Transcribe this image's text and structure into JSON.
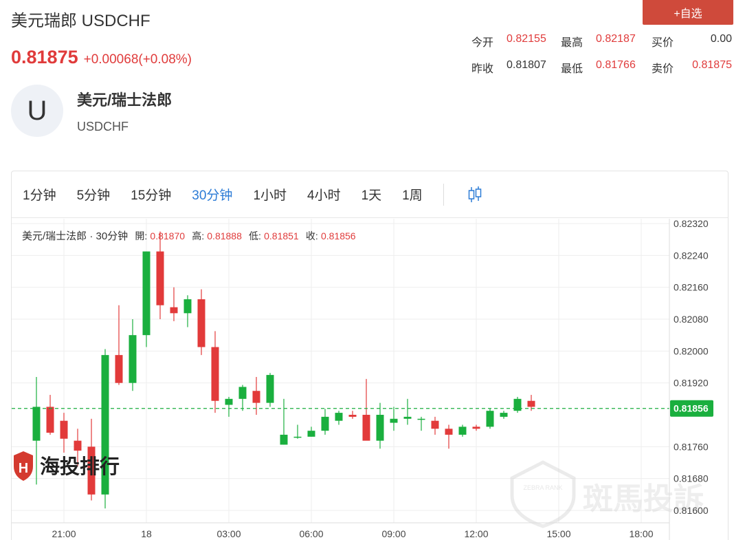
{
  "header": {
    "title": "美元瑞郎 USDCHF",
    "price": "0.81875",
    "change": "+0.00068(+0.08%)",
    "watch_button": "+自选"
  },
  "quote": {
    "open_label": "今开",
    "open": "0.82155",
    "high_label": "最高",
    "high": "0.82187",
    "bid_label": "买价",
    "bid": "0.00",
    "prev_close_label": "昨收",
    "prev_close": "0.81807",
    "low_label": "最低",
    "low": "0.81766",
    "ask_label": "卖价",
    "ask": "0.81875"
  },
  "instrument": {
    "avatar_letter": "U",
    "name": "美元/瑞士法郎",
    "code": "USDCHF"
  },
  "tabs": [
    "1分钟",
    "5分钟",
    "15分钟",
    "30分钟",
    "1小时",
    "4小时",
    "1天",
    "1周"
  ],
  "active_tab": "30分钟",
  "legend": {
    "series_name": "美元/瑞士法郎 · 30分钟",
    "open_label": "開:",
    "open": "0.81870",
    "high_label": "高:",
    "high": "0.81888",
    "low_label": "低:",
    "low": "0.81851",
    "close_label": "收:",
    "close": "0.81856"
  },
  "watermarks": {
    "left": "海投排行",
    "right": "斑馬投訴",
    "badge_text": "ZEBRA RANK"
  },
  "colors": {
    "up": "#1aaf3e",
    "down": "#e23a3a",
    "accent": "#2b7bd6",
    "button": "#cf4a3b"
  },
  "chart_data": {
    "type": "candlestick",
    "y_ticks": [
      "0.82320",
      "0.82240",
      "0.82160",
      "0.82080",
      "0.82000",
      "0.81920",
      "0.81760",
      "0.81680",
      "0.81600"
    ],
    "ylim": [
      0.8158,
      0.8232
    ],
    "x_ticks": [
      "21:00",
      "18",
      "03:00",
      "06:00",
      "09:00",
      "12:00",
      "15:00",
      "18:00"
    ],
    "current_price": 0.81856,
    "current_price_label": "0.81856",
    "candles": [
      {
        "o": 0.81775,
        "h": 0.81935,
        "l": 0.81665,
        "c": 0.8186
      },
      {
        "o": 0.8186,
        "h": 0.8189,
        "l": 0.8179,
        "c": 0.81795
      },
      {
        "o": 0.81825,
        "h": 0.81845,
        "l": 0.81745,
        "c": 0.8178
      },
      {
        "o": 0.81775,
        "h": 0.81805,
        "l": 0.8171,
        "c": 0.8175
      },
      {
        "o": 0.8176,
        "h": 0.8183,
        "l": 0.81625,
        "c": 0.8164
      },
      {
        "o": 0.8164,
        "h": 0.82005,
        "l": 0.81605,
        "c": 0.8199
      },
      {
        "o": 0.8199,
        "h": 0.82115,
        "l": 0.81915,
        "c": 0.8192
      },
      {
        "o": 0.8192,
        "h": 0.8208,
        "l": 0.819,
        "c": 0.8204
      },
      {
        "o": 0.8204,
        "h": 0.8225,
        "l": 0.8201,
        "c": 0.8225
      },
      {
        "o": 0.8225,
        "h": 0.823,
        "l": 0.8208,
        "c": 0.82115
      },
      {
        "o": 0.8211,
        "h": 0.8216,
        "l": 0.82075,
        "c": 0.82095
      },
      {
        "o": 0.82095,
        "h": 0.8214,
        "l": 0.8206,
        "c": 0.8213
      },
      {
        "o": 0.8213,
        "h": 0.82155,
        "l": 0.8199,
        "c": 0.8201
      },
      {
        "o": 0.8201,
        "h": 0.8205,
        "l": 0.81845,
        "c": 0.81875
      },
      {
        "o": 0.81865,
        "h": 0.81885,
        "l": 0.81835,
        "c": 0.8188
      },
      {
        "o": 0.8188,
        "h": 0.81915,
        "l": 0.8185,
        "c": 0.8191
      },
      {
        "o": 0.819,
        "h": 0.81935,
        "l": 0.8184,
        "c": 0.8187
      },
      {
        "o": 0.8187,
        "h": 0.81945,
        "l": 0.8186,
        "c": 0.8194
      },
      {
        "o": 0.81765,
        "h": 0.8188,
        "l": 0.81765,
        "c": 0.8179
      },
      {
        "o": 0.81785,
        "h": 0.81815,
        "l": 0.8178,
        "c": 0.81785
      },
      {
        "o": 0.81785,
        "h": 0.8181,
        "l": 0.81785,
        "c": 0.818
      },
      {
        "o": 0.818,
        "h": 0.81855,
        "l": 0.8179,
        "c": 0.81835
      },
      {
        "o": 0.81825,
        "h": 0.8185,
        "l": 0.81815,
        "c": 0.81845
      },
      {
        "o": 0.8184,
        "h": 0.8185,
        "l": 0.8183,
        "c": 0.81835
      },
      {
        "o": 0.8184,
        "h": 0.8193,
        "l": 0.81785,
        "c": 0.81775
      },
      {
        "o": 0.81775,
        "h": 0.8187,
        "l": 0.81755,
        "c": 0.8184
      },
      {
        "o": 0.8182,
        "h": 0.8186,
        "l": 0.818,
        "c": 0.8183
      },
      {
        "o": 0.8183,
        "h": 0.8188,
        "l": 0.81815,
        "c": 0.81835
      },
      {
        "o": 0.8183,
        "h": 0.81835,
        "l": 0.818,
        "c": 0.8183
      },
      {
        "o": 0.81825,
        "h": 0.81835,
        "l": 0.8179,
        "c": 0.81805
      },
      {
        "o": 0.81805,
        "h": 0.81815,
        "l": 0.81755,
        "c": 0.8179
      },
      {
        "o": 0.8179,
        "h": 0.81815,
        "l": 0.81785,
        "c": 0.8181
      },
      {
        "o": 0.8181,
        "h": 0.81815,
        "l": 0.818,
        "c": 0.81805
      },
      {
        "o": 0.8181,
        "h": 0.81855,
        "l": 0.81805,
        "c": 0.8185
      },
      {
        "o": 0.81835,
        "h": 0.8185,
        "l": 0.8183,
        "c": 0.81845
      },
      {
        "o": 0.8185,
        "h": 0.81885,
        "l": 0.81845,
        "c": 0.8188
      },
      {
        "o": 0.81875,
        "h": 0.8189,
        "l": 0.8185,
        "c": 0.8186
      }
    ]
  }
}
